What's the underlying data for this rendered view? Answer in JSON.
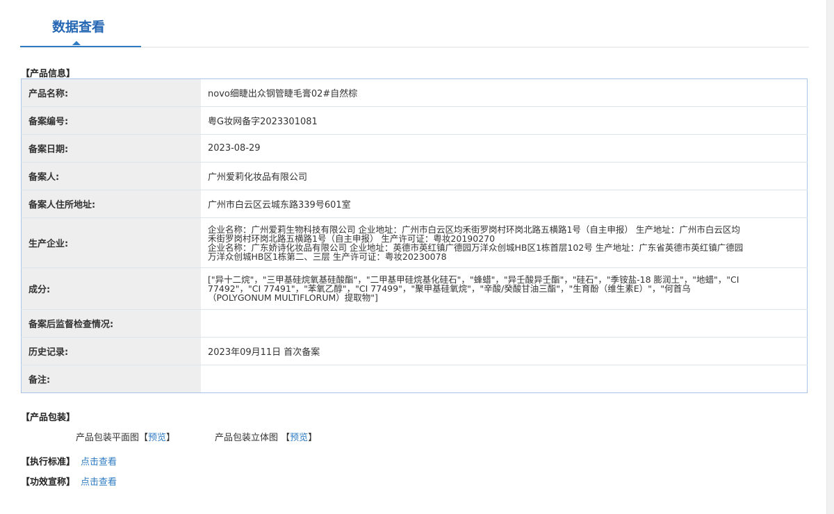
{
  "tab": {
    "title": "数据查看"
  },
  "product_info": {
    "section_title": "【产品信息】",
    "rows": [
      {
        "label": "产品名称:",
        "value": [
          "novo细睫出众钢管睫毛膏02#自然棕"
        ]
      },
      {
        "label": "备案编号:",
        "value": [
          "粤G妆网备字2023301081"
        ]
      },
      {
        "label": "备案日期:",
        "value": [
          "2023-08-29"
        ]
      },
      {
        "label": "备案人:",
        "value": [
          "广州爱莉化妆品有限公司"
        ]
      },
      {
        "label": "备案人住所地址:",
        "value": [
          "广州市白云区云城东路339号601室"
        ]
      },
      {
        "label": "生产企业:",
        "value": [
          "企业名称：广州爱莉生物科技有限公司 企业地址：广州市白云区均禾街罗岗村环岗北路五横路1号（自主申报） 生产地址：广州市白云区均",
          "禾街罗岗村环岗北路五横路1号（自主申报） 生产许可证：粤妆20190270",
          "企业名称：广东娇诗化妆品有限公司 企业地址：英德市英红镇广德园万洋众创城HB区1栋首层102号 生产地址：广东省英德市英红镇广德园",
          "万洋众创城HB区1栋第二、三层 生产许可证：粤妆20230078"
        ]
      },
      {
        "label": "成分:",
        "value": [
          "[\"异十二烷\"，\"三甲基硅烷氧基硅酸酯\"，\"二甲基甲硅烷基化硅石\"，\"蜂蜡\"，\"异壬酸异壬酯\"，\"硅石\"，\"季铵盐-18 膨润土\"，\"地蜡\"，\"CI",
          "77492\"，\"CI 77491\"，\"苯氧乙醇\"，\"CI 77499\"，\"聚甲基硅氧烷\"，\"辛酸/癸酸甘油三酯\"，\"生育酚（维生素E）\"，\"何首乌",
          "（POLYGONUM MULTIFLORUM）提取物\"]"
        ]
      },
      {
        "label": "备案后监督检查情况:",
        "value": [
          ""
        ]
      },
      {
        "label": "历史记录:",
        "value": [
          "2023年09月11日 首次备案"
        ]
      },
      {
        "label": "备注:",
        "value": [
          ""
        ]
      }
    ]
  },
  "packaging": {
    "section_title": "【产品包装】",
    "flat_label": "产品包装平面图",
    "stereo_label": "产品包装立体图",
    "bracket_open": "【",
    "bracket_close": "】",
    "preview_link": "预览"
  },
  "standard": {
    "label": "【执行标准】",
    "link": "点击查看"
  },
  "efficacy": {
    "label": "【功效宣称】",
    "link": "点击查看"
  }
}
